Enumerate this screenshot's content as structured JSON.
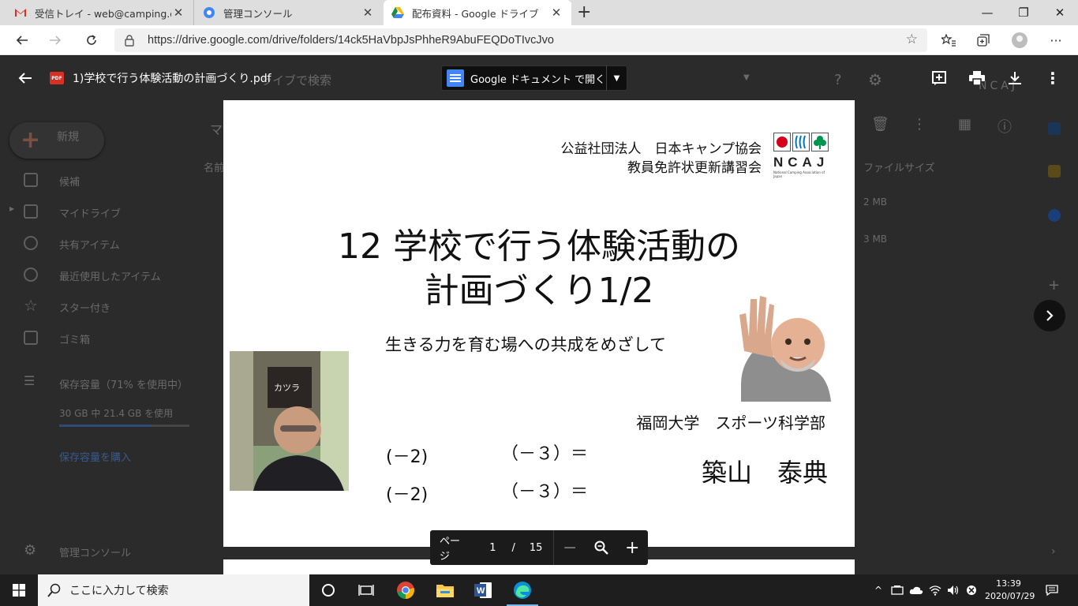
{
  "browser": {
    "tabs": [
      {
        "title": "受信トレイ - web@camping.or.jp",
        "favicon": "gmail-icon"
      },
      {
        "title": "管理コンソール",
        "favicon": "admin-console-icon"
      },
      {
        "title": "配布資料 - Google ドライブ",
        "favicon": "google-drive-icon",
        "active": true
      }
    ],
    "url": "https://drive.google.com/drive/folders/14ck5HaVbpJsPhheR9AbuFEQDoTIvcJvo"
  },
  "drive_background": {
    "search_placeholder": "ライブで検索",
    "new_button": "新規",
    "sidebar": [
      "候補",
      "マイドライブ",
      "共有アイテム",
      "最近使用したアイテム",
      "スター付き",
      "ゴミ箱"
    ],
    "storage_label": "保存容量（71% を使用中）",
    "storage_used": "30 GB 中 21.4 GB を使用",
    "storage_fraction": 0.71,
    "buy_storage": "保存容量を購入",
    "admin_console": "管理コンソール",
    "crumb": "マ",
    "col_name": "名前",
    "col_size": "ファイルサイズ",
    "sizes": [
      "2 MB",
      "3 MB"
    ]
  },
  "viewer": {
    "filename": "1)学校で行う体験活動の計画づくり.pdf",
    "file_type_badge": "PDF",
    "open_with": "Google ドキュメント で開く",
    "page_label": "ページ",
    "current_page": "1",
    "page_sep": "/",
    "total_pages": "15"
  },
  "slide": {
    "org_line1": "公益社団法人　日本キャンプ協会",
    "org_line2": "教員免許状更新講習会",
    "logo_text": "NCAJ",
    "logo_small": "National Camping Association of Japan",
    "title_line1": "12 学校で行う体験活動の",
    "title_line2": "計画づくり1/2",
    "subtitle": "生きる力を育む場への共成をめざして",
    "university": "福岡大学　スポーツ科学部",
    "author": "築山　泰典",
    "eq1_left": "(－2)",
    "eq1_right": "（－３）＝",
    "eq2_left": "(－2)",
    "eq2_right": "（－３）＝",
    "sign_text": "カツラ"
  },
  "taskbar": {
    "search_placeholder": "ここに入力して検索",
    "time": "13:39",
    "date": "2020/07/29"
  }
}
